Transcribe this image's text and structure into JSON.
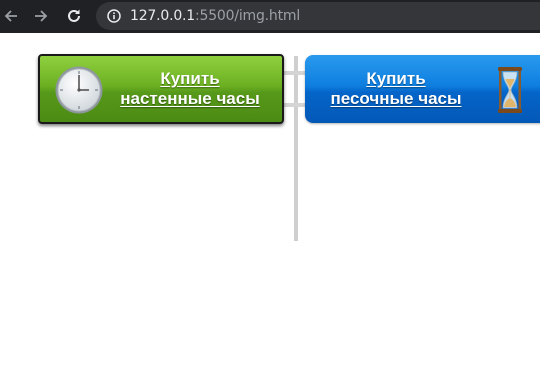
{
  "browser": {
    "url_host": "127.0.0.1",
    "url_rest": ":5500/img.html",
    "icons": {
      "back": "arrow-left-icon",
      "forward": "arrow-right-icon",
      "reload": "reload-icon",
      "site_info": "info-circle-icon"
    }
  },
  "buttons": {
    "wall_clock": {
      "line1": "Купить",
      "line2": "настенные часы",
      "icon": "wall-clock-icon",
      "color": "#6cb022"
    },
    "hourglass": {
      "line1": "Купить",
      "line2": "песочные часы",
      "icon": "hourglass-icon",
      "color": "#0e7fe0"
    }
  }
}
